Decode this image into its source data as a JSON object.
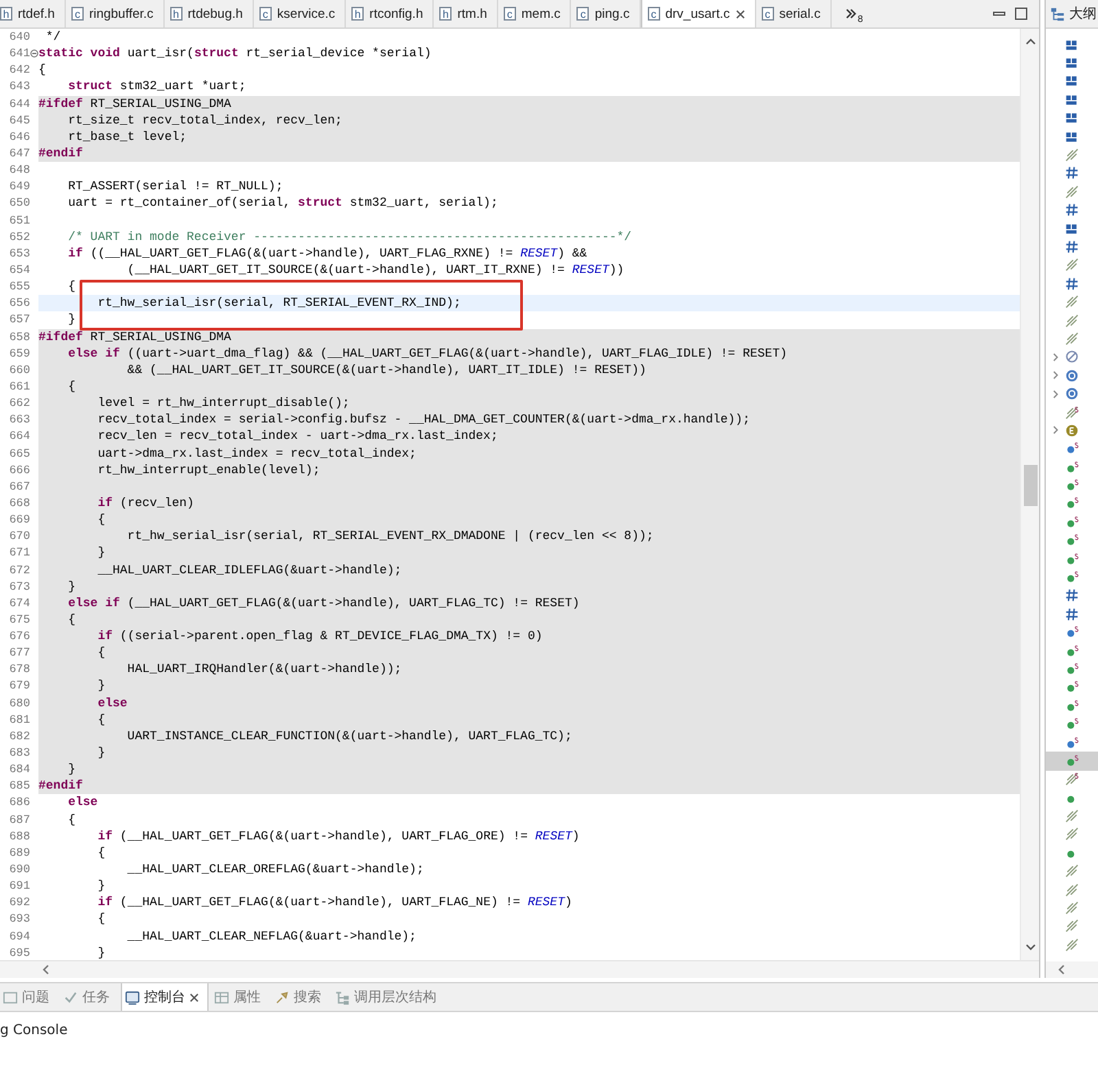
{
  "editor": {
    "tabs": [
      {
        "label": "rtdef.h",
        "file_type": "h",
        "selected": false
      },
      {
        "label": "ringbuffer.c",
        "file_type": "c",
        "selected": false
      },
      {
        "label": "rtdebug.h",
        "file_type": "h",
        "selected": false
      },
      {
        "label": "kservice.c",
        "file_type": "c",
        "selected": false
      },
      {
        "label": "rtconfig.h",
        "file_type": "h",
        "selected": false
      },
      {
        "label": "rtm.h",
        "file_type": "h",
        "selected": false
      },
      {
        "label": "mem.c",
        "file_type": "c",
        "selected": false
      },
      {
        "label": "ping.c",
        "file_type": "c",
        "selected": false
      },
      {
        "label": "drv_usart.c",
        "file_type": "c",
        "selected": true
      },
      {
        "label": "serial.c",
        "file_type": "c",
        "selected": false
      }
    ],
    "overflow_count": "8",
    "lines": [
      {
        "number": "640",
        "text": " */",
        "inactive": false,
        "current": false,
        "boxed": false,
        "foldable": false
      },
      {
        "number": "641",
        "text": "**static void** uart_isr(**struct** rt_serial_device *serial)",
        "inactive": false,
        "current": false,
        "boxed": false,
        "foldable": true
      },
      {
        "number": "642",
        "text": "{",
        "inactive": false,
        "current": false,
        "boxed": false,
        "foldable": false
      },
      {
        "number": "643",
        "text": "    **struct** stm32_uart *uart;",
        "inactive": false,
        "current": false,
        "boxed": false,
        "foldable": false
      },
      {
        "number": "644",
        "text": "**#ifdef** RT_SERIAL_USING_DMA",
        "inactive": true,
        "current": false,
        "boxed": false,
        "foldable": false
      },
      {
        "number": "645",
        "text": "    rt_size_t recv_total_index, recv_len;",
        "inactive": true,
        "current": false,
        "boxed": false,
        "foldable": false
      },
      {
        "number": "646",
        "text": "    rt_base_t level;",
        "inactive": true,
        "current": false,
        "boxed": false,
        "foldable": false
      },
      {
        "number": "647",
        "text": "**#endif**",
        "inactive": true,
        "current": false,
        "boxed": false,
        "foldable": false
      },
      {
        "number": "648",
        "inactive": false,
        "current": false,
        "boxed": false,
        "foldable": false
      },
      {
        "number": "649",
        "text": "    RT_ASSERT(serial != RT_NULL);",
        "inactive": false,
        "current": false,
        "boxed": false,
        "foldable": false
      },
      {
        "number": "650",
        "text": "    uart = rt_container_of(serial, **struct** stm32_uart, serial);",
        "inactive": false,
        "current": false,
        "boxed": false,
        "foldable": false
      },
      {
        "number": "651",
        "inactive": false,
        "current": false,
        "boxed": false,
        "foldable": false
      },
      {
        "number": "652",
        "text": "    /* UART in mode Receiver -------------------------------------------------*/",
        "kind": "comment",
        "inactive": false,
        "current": false,
        "boxed": false,
        "foldable": false
      },
      {
        "number": "653",
        "text": "    **if** ((__HAL_UART_GET_FLAG(&(uart->handle), UART_FLAG_RXNE) != *RESET*) &&",
        "inactive": false,
        "current": false,
        "boxed": false,
        "foldable": false
      },
      {
        "number": "654",
        "text": "            (__HAL_UART_GET_IT_SOURCE(&(uart->handle), UART_IT_RXNE) != *RESET*))",
        "inactive": false,
        "current": false,
        "boxed": false,
        "foldable": false
      },
      {
        "number": "655",
        "text": "    {",
        "inactive": false,
        "current": false,
        "boxed": true,
        "foldable": false
      },
      {
        "number": "656",
        "text": "        rt_hw_serial_isr(serial, RT_SERIAL_EVENT_RX_IND);",
        "inactive": false,
        "current": true,
        "boxed": true,
        "foldable": false
      },
      {
        "number": "657",
        "text": "    }",
        "inactive": false,
        "current": false,
        "boxed": true,
        "foldable": false
      },
      {
        "number": "658",
        "text": "**#ifdef** RT_SERIAL_USING_DMA",
        "inactive": true,
        "current": false,
        "boxed": false,
        "foldable": false
      },
      {
        "number": "659",
        "text": "    **else if** ((uart->uart_dma_flag) && (__HAL_UART_GET_FLAG(&(uart->handle), UART_FLAG_IDLE) != RESET)",
        "inactive": true,
        "current": false,
        "boxed": false,
        "foldable": false
      },
      {
        "number": "660",
        "text": "            && (__HAL_UART_GET_IT_SOURCE(&(uart->handle), UART_IT_IDLE) != RESET))",
        "inactive": true,
        "current": false,
        "boxed": false,
        "foldable": false
      },
      {
        "number": "661",
        "text": "    {",
        "inactive": true,
        "current": false,
        "boxed": false,
        "foldable": false
      },
      {
        "number": "662",
        "text": "        level = rt_hw_interrupt_disable();",
        "inactive": true,
        "current": false,
        "boxed": false,
        "foldable": false
      },
      {
        "number": "663",
        "text": "        recv_total_index = serial->config.bufsz - __HAL_DMA_GET_COUNTER(&(uart->dma_rx.handle));",
        "inactive": true,
        "current": false,
        "boxed": false,
        "foldable": false
      },
      {
        "number": "664",
        "text": "        recv_len = recv_total_index - uart->dma_rx.last_index;",
        "inactive": true,
        "current": false,
        "boxed": false,
        "foldable": false
      },
      {
        "number": "665",
        "text": "        uart->dma_rx.last_index = recv_total_index;",
        "inactive": true,
        "current": false,
        "boxed": false,
        "foldable": false
      },
      {
        "number": "666",
        "text": "        rt_hw_interrupt_enable(level);",
        "inactive": true,
        "current": false,
        "boxed": false,
        "foldable": false
      },
      {
        "number": "667",
        "inactive": true,
        "current": false,
        "boxed": false,
        "foldable": false
      },
      {
        "number": "668",
        "text": "        **if** (recv_len)",
        "inactive": true,
        "current": false,
        "boxed": false,
        "foldable": false
      },
      {
        "number": "669",
        "text": "        {",
        "inactive": true,
        "current": false,
        "boxed": false,
        "foldable": false
      },
      {
        "number": "670",
        "text": "            rt_hw_serial_isr(serial, RT_SERIAL_EVENT_RX_DMADONE | (recv_len << 8));",
        "inactive": true,
        "current": false,
        "boxed": false,
        "foldable": false
      },
      {
        "number": "671",
        "text": "        }",
        "inactive": true,
        "current": false,
        "boxed": false,
        "foldable": false
      },
      {
        "number": "672",
        "text": "        __HAL_UART_CLEAR_IDLEFLAG(&uart->handle);",
        "inactive": true,
        "current": false,
        "boxed": false,
        "foldable": false
      },
      {
        "number": "673",
        "text": "    }",
        "inactive": true,
        "current": false,
        "boxed": false,
        "foldable": false
      },
      {
        "number": "674",
        "text": "    **else if** (__HAL_UART_GET_FLAG(&(uart->handle), UART_FLAG_TC) != RESET)",
        "inactive": true,
        "current": false,
        "boxed": false,
        "foldable": false
      },
      {
        "number": "675",
        "text": "    {",
        "inactive": true,
        "current": false,
        "boxed": false,
        "foldable": false
      },
      {
        "number": "676",
        "text": "        **if** ((serial->parent.open_flag & RT_DEVICE_FLAG_DMA_TX) != 0)",
        "inactive": true,
        "current": false,
        "boxed": false,
        "foldable": false
      },
      {
        "number": "677",
        "text": "        {",
        "inactive": true,
        "current": false,
        "boxed": false,
        "foldable": false
      },
      {
        "number": "678",
        "text": "            HAL_UART_IRQHandler(&(uart->handle));",
        "inactive": true,
        "current": false,
        "boxed": false,
        "foldable": false
      },
      {
        "number": "679",
        "text": "        }",
        "inactive": true,
        "current": false,
        "boxed": false,
        "foldable": false
      },
      {
        "number": "680",
        "text": "        **else**",
        "inactive": true,
        "current": false,
        "boxed": false,
        "foldable": false
      },
      {
        "number": "681",
        "text": "        {",
        "inactive": true,
        "current": false,
        "boxed": false,
        "foldable": false
      },
      {
        "number": "682",
        "text": "            UART_INSTANCE_CLEAR_FUNCTION(&(uart->handle), UART_FLAG_TC);",
        "inactive": true,
        "current": false,
        "boxed": false,
        "foldable": false
      },
      {
        "number": "683",
        "text": "        }",
        "inactive": true,
        "current": false,
        "boxed": false,
        "foldable": false
      },
      {
        "number": "684",
        "text": "    }",
        "inactive": true,
        "current": false,
        "boxed": false,
        "foldable": false
      },
      {
        "number": "685",
        "text": "**#endif**",
        "inactive": true,
        "current": false,
        "boxed": false,
        "foldable": false
      },
      {
        "number": "686",
        "text": "    **else**",
        "inactive": false,
        "current": false,
        "boxed": false,
        "foldable": false
      },
      {
        "number": "687",
        "text": "    {",
        "inactive": false,
        "current": false,
        "boxed": false,
        "foldable": false
      },
      {
        "number": "688",
        "text": "        **if** (__HAL_UART_GET_FLAG(&(uart->handle), UART_FLAG_ORE) != *RESET*)",
        "inactive": false,
        "current": false,
        "boxed": false,
        "foldable": false
      },
      {
        "number": "689",
        "text": "        {",
        "inactive": false,
        "current": false,
        "boxed": false,
        "foldable": false
      },
      {
        "number": "690",
        "text": "            __HAL_UART_CLEAR_OREFLAG(&uart->handle);",
        "inactive": false,
        "current": false,
        "boxed": false,
        "foldable": false
      },
      {
        "number": "691",
        "text": "        }",
        "inactive": false,
        "current": false,
        "boxed": false,
        "foldable": false
      },
      {
        "number": "692",
        "text": "        **if** (__HAL_UART_GET_FLAG(&(uart->handle), UART_FLAG_NE) != *RESET*)",
        "inactive": false,
        "current": false,
        "boxed": false,
        "foldable": false
      },
      {
        "number": "693",
        "text": "        {",
        "inactive": false,
        "current": false,
        "boxed": false,
        "foldable": false
      },
      {
        "number": "694",
        "text": "            __HAL_UART_CLEAR_NEFLAG(&uart->handle);",
        "inactive": false,
        "current": false,
        "boxed": false,
        "foldable": false
      },
      {
        "number": "695",
        "text": "        }",
        "inactive": false,
        "current": false,
        "boxed": false,
        "foldable": false
      }
    ]
  },
  "outline": {
    "title": "大纲",
    "items": [
      {
        "kind": "struct",
        "static": false,
        "expandable": false,
        "selected": false
      },
      {
        "kind": "struct",
        "static": false,
        "expandable": false,
        "selected": false
      },
      {
        "kind": "struct",
        "static": false,
        "expandable": false,
        "selected": false
      },
      {
        "kind": "struct",
        "static": false,
        "expandable": false,
        "selected": false
      },
      {
        "kind": "struct",
        "static": false,
        "expandable": false,
        "selected": false
      },
      {
        "kind": "struct",
        "static": false,
        "expandable": false,
        "selected": false
      },
      {
        "kind": "inactive",
        "static": false,
        "expandable": false,
        "selected": false
      },
      {
        "kind": "macro",
        "static": false,
        "expandable": false,
        "selected": false
      },
      {
        "kind": "inactive",
        "static": false,
        "expandable": false,
        "selected": false
      },
      {
        "kind": "macro",
        "static": false,
        "expandable": false,
        "selected": false
      },
      {
        "kind": "struct",
        "static": false,
        "expandable": false,
        "selected": false
      },
      {
        "kind": "macro",
        "static": false,
        "expandable": false,
        "selected": false
      },
      {
        "kind": "inactive",
        "static": false,
        "expandable": false,
        "selected": false
      },
      {
        "kind": "macro",
        "static": false,
        "expandable": false,
        "selected": false
      },
      {
        "kind": "inactive",
        "static": false,
        "expandable": false,
        "selected": false
      },
      {
        "kind": "inactive",
        "static": false,
        "expandable": false,
        "selected": false
      },
      {
        "kind": "inactive",
        "static": false,
        "expandable": false,
        "selected": false
      },
      {
        "kind": "hidden-type",
        "static": false,
        "expandable": true,
        "selected": false
      },
      {
        "kind": "type",
        "static": false,
        "expandable": true,
        "selected": false
      },
      {
        "kind": "type",
        "static": false,
        "expandable": true,
        "selected": false
      },
      {
        "kind": "inactive",
        "static": true,
        "expandable": false,
        "selected": false
      },
      {
        "kind": "enum",
        "static": false,
        "expandable": true,
        "selected": false
      },
      {
        "kind": "declaration",
        "static": true,
        "expandable": false,
        "selected": false
      },
      {
        "kind": "function",
        "static": true,
        "expandable": false,
        "selected": false
      },
      {
        "kind": "function",
        "static": true,
        "expandable": false,
        "selected": false
      },
      {
        "kind": "function",
        "static": true,
        "expandable": false,
        "selected": false
      },
      {
        "kind": "function",
        "static": true,
        "expandable": false,
        "selected": false
      },
      {
        "kind": "function",
        "static": true,
        "expandable": false,
        "selected": false
      },
      {
        "kind": "function",
        "static": true,
        "expandable": false,
        "selected": false
      },
      {
        "kind": "function",
        "static": true,
        "expandable": false,
        "selected": false
      },
      {
        "kind": "macro",
        "static": false,
        "expandable": false,
        "selected": false
      },
      {
        "kind": "macro",
        "static": false,
        "expandable": false,
        "selected": false
      },
      {
        "kind": "declaration",
        "static": true,
        "expandable": false,
        "selected": false
      },
      {
        "kind": "function",
        "static": true,
        "expandable": false,
        "selected": false
      },
      {
        "kind": "function",
        "static": true,
        "expandable": false,
        "selected": false
      },
      {
        "kind": "function",
        "static": true,
        "expandable": false,
        "selected": false
      },
      {
        "kind": "function",
        "static": true,
        "expandable": false,
        "selected": false
      },
      {
        "kind": "function",
        "static": true,
        "expandable": false,
        "selected": false
      },
      {
        "kind": "declaration",
        "static": true,
        "expandable": false,
        "selected": false
      },
      {
        "kind": "function",
        "static": true,
        "expandable": false,
        "selected": true
      },
      {
        "kind": "inactive",
        "static": true,
        "expandable": false,
        "selected": false
      },
      {
        "kind": "function",
        "static": false,
        "expandable": false,
        "selected": false
      },
      {
        "kind": "inactive",
        "static": false,
        "expandable": false,
        "selected": false
      },
      {
        "kind": "inactive",
        "static": false,
        "expandable": false,
        "selected": false
      },
      {
        "kind": "function",
        "static": false,
        "expandable": false,
        "selected": false
      },
      {
        "kind": "inactive",
        "static": false,
        "expandable": false,
        "selected": false
      },
      {
        "kind": "inactive",
        "static": false,
        "expandable": false,
        "selected": false
      },
      {
        "kind": "inactive",
        "static": false,
        "expandable": false,
        "selected": false
      },
      {
        "kind": "inactive",
        "static": false,
        "expandable": false,
        "selected": false
      },
      {
        "kind": "inactive",
        "static": false,
        "expandable": false,
        "selected": false
      }
    ]
  },
  "bottom_panel": {
    "tabs": [
      {
        "label": "问题",
        "selected": false
      },
      {
        "label": "任务",
        "selected": false
      },
      {
        "label": "控制台",
        "selected": true
      },
      {
        "label": "属性",
        "selected": false
      },
      {
        "label": "搜索",
        "selected": false
      },
      {
        "label": "调用层次结构",
        "selected": false
      }
    ],
    "console_title": "g Console"
  }
}
